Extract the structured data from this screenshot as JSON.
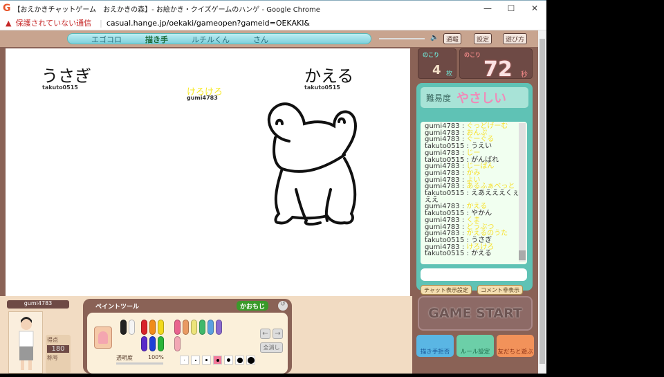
{
  "browser": {
    "title": "【おえかきチャットゲーム　おえかきの森】- お絵かき・クイズゲームのハンゲ - Google Chrome",
    "security": "保護されていない通信",
    "url": "casual.hange.jp/oekaki/gameopen?gameid=OEKAKI&"
  },
  "topbar": {
    "players": [
      "エゴコロ",
      "描き手",
      "ルチルくん",
      "さん"
    ],
    "buttons": [
      "通報",
      "設定",
      "遊び方"
    ]
  },
  "canvas": {
    "guesses": [
      {
        "word": "うさぎ",
        "user": "takuto0515"
      },
      {
        "word": "けろけろ",
        "user": "gumi4783"
      },
      {
        "word": "かえる",
        "user": "takuto0515"
      }
    ]
  },
  "status": {
    "remaining_label": "のこり",
    "remaining_count": "4",
    "count_unit": "枚",
    "time_label": "のこり",
    "time_value": "72",
    "time_unit": "秒"
  },
  "difficulty": {
    "label": "難易度",
    "value": "やさしい"
  },
  "chat": {
    "messages": [
      {
        "user": "gumi4783",
        "text": "ぐっどげーむ",
        "mine": true
      },
      {
        "user": "gumi4783",
        "text": "おんぷ",
        "mine": true
      },
      {
        "user": "gumi4783",
        "text": "ぐーぐる",
        "mine": true
      },
      {
        "user": "takuto0515",
        "text": "うえい",
        "mine": false
      },
      {
        "user": "gumi4783",
        "text": "じー",
        "mine": true
      },
      {
        "user": "takuto0515",
        "text": "がんばれ",
        "mine": false
      },
      {
        "user": "gumi4783",
        "text": "じーぱん",
        "mine": true
      },
      {
        "user": "gumi4783",
        "text": "かみ",
        "mine": true
      },
      {
        "user": "gumi4783",
        "text": "よい",
        "mine": true
      },
      {
        "user": "gumi4783",
        "text": "あるふぁべっと",
        "mine": true
      },
      {
        "user": "takuto0515",
        "text": "えあえええくぇええ",
        "mine": false
      },
      {
        "user": "gumi4783",
        "text": "かえる",
        "mine": true
      },
      {
        "user": "takuto0515",
        "text": "やかん",
        "mine": false
      },
      {
        "user": "gumi4783",
        "text": "くま",
        "mine": true
      },
      {
        "user": "gumi4783",
        "text": "どうぶつ",
        "mine": true
      },
      {
        "user": "gumi4783",
        "text": "かえるのうた",
        "mine": true
      },
      {
        "user": "takuto0515",
        "text": "うさぎ",
        "mine": false
      },
      {
        "user": "gumi4783",
        "text": "けろけろ",
        "mine": true
      },
      {
        "user": "takuto0515",
        "text": "かえる",
        "mine": false
      }
    ],
    "input_value": "",
    "display_settings": "チャット表示設定",
    "hide_comments": "コメント非表示"
  },
  "game_start": "GAME START",
  "bottom_buttons": [
    "描き手拒否",
    "ルール設定",
    "友だちと遊ぶ"
  ],
  "player": {
    "name": "gumi4783",
    "score_label": "得点",
    "score": "180",
    "title_label": "称号"
  },
  "paint": {
    "title": "ペイントツール",
    "kaomoji": "かおもじ",
    "opacity_label": "透明度",
    "opacity": "100%",
    "clear": "全消し",
    "colors": [
      "#222222",
      "#f4f4f4",
      "#d8232a",
      "#f08c1a",
      "#f2d91c",
      "#5a2bc9",
      "#1f3fd6",
      "#2bb53a",
      "#e9638e",
      "#e99a62",
      "#ede47a",
      "#3fb86a",
      "#5aa0e0",
      "#8b6ad0",
      "#f2a7b4"
    ]
  }
}
